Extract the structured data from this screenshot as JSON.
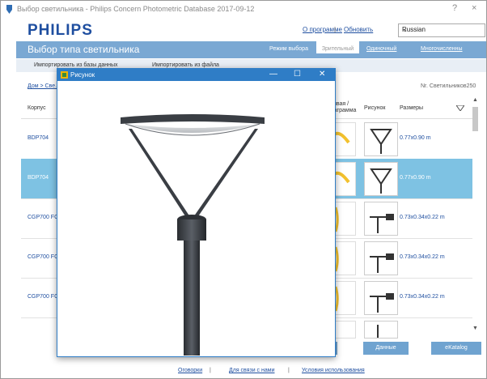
{
  "window": {
    "title": "Выбор светильника - Philips Concern Photometric Database 2017-09-12",
    "help_label": "?",
    "close_label": "×"
  },
  "header": {
    "logo": "PHILIPS",
    "about_link": "О программе",
    "update_link": "Обновить",
    "separator": "|",
    "language": "Russian"
  },
  "bluebar": {
    "heading": "Выбор типа светильника",
    "tabs": [
      "Режим выбора",
      "Зрительный",
      "Одиночный",
      "Многочисленны"
    ]
  },
  "subbar": {
    "items": [
      "Импортировать из базы данных",
      "Импортировать из файла"
    ]
  },
  "breadcrumb": "Дом > Све...",
  "count_label": "Nr. Светильников250",
  "columns": {
    "housing": "Корпус",
    "diagram": "Кривая / Диаграмма",
    "picture": "Рисунок",
    "size": "Размеры"
  },
  "rows": [
    {
      "name": "BDP704",
      "size": "0.77x0.90 m",
      "selected": false
    },
    {
      "name": "BDP704",
      "size": "0.77x0.90 m",
      "selected": true
    },
    {
      "name": "CGP700 FG",
      "size": "0.73x0.34x0.22 m",
      "selected": false
    },
    {
      "name": "CGP700 FG",
      "size": "0.73x0.34x0.22 m",
      "selected": false
    },
    {
      "name": "CGP700 FG",
      "size": "0.73x0.34x0.22 m",
      "selected": false
    }
  ],
  "buttons": {
    "ok": "ОК",
    "data": "Данные",
    "catalog": "eKatalog"
  },
  "footer": {
    "disclaimer": "Оговорки",
    "contact": "Для связи с нами",
    "terms": "Условия использования",
    "separator": "|"
  },
  "popup": {
    "title": "Рисунок",
    "minimize": "—",
    "maximize": "☐",
    "close": "✕"
  },
  "colors": {
    "brand": "#1f4fa0",
    "bar": "#7aa8d3",
    "selected_row": "#7ec2e3",
    "popup_title": "#2f7dc6"
  }
}
